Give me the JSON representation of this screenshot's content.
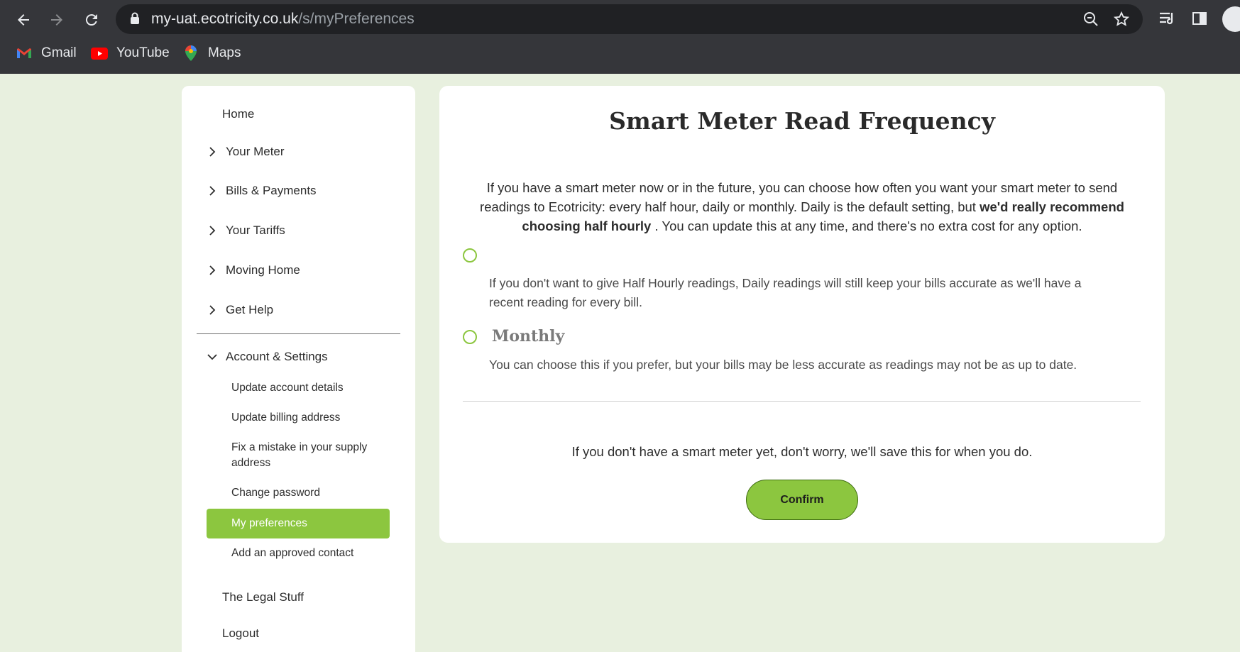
{
  "browser": {
    "url_domain": "my-uat.ecotricity.co.uk",
    "url_path": "/s/myPreferences",
    "bookmarks": [
      {
        "label": "Gmail",
        "icon": "gmail-icon"
      },
      {
        "label": "YouTube",
        "icon": "youtube-icon"
      },
      {
        "label": "Maps",
        "icon": "maps-icon"
      }
    ]
  },
  "sidebar": {
    "home": "Home",
    "items": [
      {
        "label": "Your Meter"
      },
      {
        "label": "Bills & Payments"
      },
      {
        "label": "Your Tariffs"
      },
      {
        "label": "Moving Home"
      },
      {
        "label": "Get Help"
      }
    ],
    "account": {
      "label": "Account & Settings",
      "children": [
        {
          "label": "Update account details"
        },
        {
          "label": "Update billing address"
        },
        {
          "label": "Fix a mistake in your supply address"
        },
        {
          "label": "Change password"
        },
        {
          "label": "My preferences",
          "active": true
        },
        {
          "label": "Add an approved contact"
        }
      ]
    },
    "legal": "The Legal Stuff",
    "logout": "Logout"
  },
  "main": {
    "title": "Smart Meter Read Frequency",
    "intro_text": "If you have a smart meter now or in the future, you can choose how often you want your smart meter to send readings to Ecotricity: every half hour, daily or monthly. Daily is the default setting, but",
    "intro_bold": "we'd really recommend choosing half hourly",
    "intro_tail": ". You can update this at any time, and there's no extra cost for any option.",
    "options": [
      {
        "title": "",
        "description": "If you don't want to give Half Hourly readings, Daily readings will still keep your bills accurate as we'll have a recent reading for every bill.",
        "selected": false
      },
      {
        "title": "Monthly",
        "description": "You can choose this if you prefer, but your bills may be less accurate as readings may not be as up to date.",
        "selected": false
      }
    ],
    "note": "If you don't have a smart meter yet, don't worry, we'll save this for when you do.",
    "confirm_label": "Confirm"
  },
  "colors": {
    "accent": "#8cc63f",
    "page_background": "#e8f0df",
    "chrome": "#35363a"
  }
}
